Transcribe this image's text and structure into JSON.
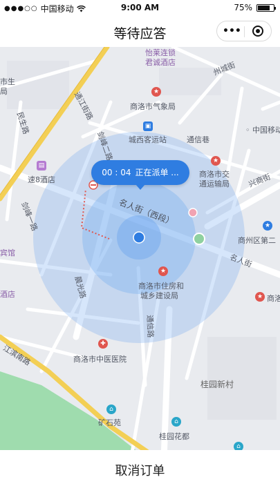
{
  "status_bar": {
    "carrier": "中国移动",
    "time": "9:00 AM",
    "battery": "75%",
    "battery_level": 0.75
  },
  "nav": {
    "title": "等待应答",
    "more_glyph": "•••"
  },
  "bubble": {
    "timer": "00 : 04",
    "text": "正在派单 ..."
  },
  "map": {
    "roads": {
      "zhouchengjie": "州城街",
      "tongjiang": "通江街路",
      "minsheng": "民生路",
      "tongxinxiang": "通信巷",
      "jianfeng_1": "剑峰一路",
      "jianfeng_2": "剑峰二路",
      "mingrenjie_west": "名人街（西段）",
      "mingrenjie": "名人街",
      "xingshangjie": "兴商街",
      "chenguang": "晨光路",
      "tongxin": "通信路",
      "jiangbin": "江滨南路"
    },
    "pois": {
      "yilai": "怡莱连锁",
      "juncheng": "君诚酒店",
      "qixiang": "商洛市气象局",
      "chengxi": "城西客运站",
      "zhongguoyidong": "中国移动",
      "sujiu8": "速8酒店",
      "jiaotong_1": "商洛市交",
      "jiaotong_2": "通运输局",
      "shangzhou": "商州区第二",
      "zhufang_1": "商洛市住房和",
      "zhufang_2": "城乡建设局",
      "shang_partial": "商洛",
      "zhongyi": "商洛市中医医院",
      "guiyuan_xincun": "桂园新村",
      "kuangshiyuan": "矿石苑",
      "guiyuan_huadu": "桂园花都",
      "binguan": "宾馆",
      "jiudian": "酒店",
      "shisheng_1": "市生",
      "shisheng_2": "局"
    }
  },
  "bottom": {
    "cancel_label": "取消订单"
  },
  "colors": {
    "accent": "#2f7de1",
    "pin_red": "#e0564f",
    "pin_blue": "#2f7de1"
  }
}
